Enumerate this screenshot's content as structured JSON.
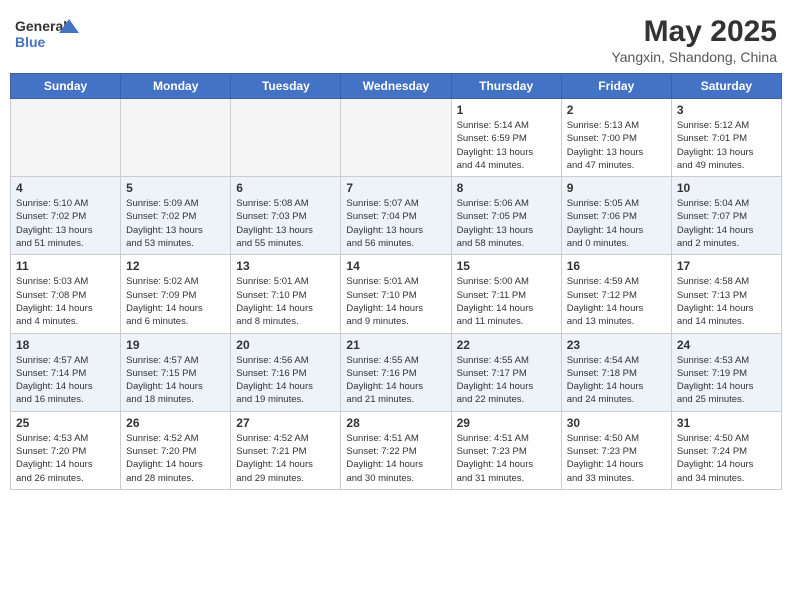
{
  "header": {
    "logo_line1": "General",
    "logo_line2": "Blue",
    "month_title": "May 2025",
    "location": "Yangxin, Shandong, China"
  },
  "days_of_week": [
    "Sunday",
    "Monday",
    "Tuesday",
    "Wednesday",
    "Thursday",
    "Friday",
    "Saturday"
  ],
  "weeks": [
    [
      {
        "day": "",
        "empty": true
      },
      {
        "day": "",
        "empty": true
      },
      {
        "day": "",
        "empty": true
      },
      {
        "day": "",
        "empty": true
      },
      {
        "day": "1",
        "info": "Sunrise: 5:14 AM\nSunset: 6:59 PM\nDaylight: 13 hours\nand 44 minutes."
      },
      {
        "day": "2",
        "info": "Sunrise: 5:13 AM\nSunset: 7:00 PM\nDaylight: 13 hours\nand 47 minutes."
      },
      {
        "day": "3",
        "info": "Sunrise: 5:12 AM\nSunset: 7:01 PM\nDaylight: 13 hours\nand 49 minutes."
      }
    ],
    [
      {
        "day": "4",
        "info": "Sunrise: 5:10 AM\nSunset: 7:02 PM\nDaylight: 13 hours\nand 51 minutes."
      },
      {
        "day": "5",
        "info": "Sunrise: 5:09 AM\nSunset: 7:02 PM\nDaylight: 13 hours\nand 53 minutes."
      },
      {
        "day": "6",
        "info": "Sunrise: 5:08 AM\nSunset: 7:03 PM\nDaylight: 13 hours\nand 55 minutes."
      },
      {
        "day": "7",
        "info": "Sunrise: 5:07 AM\nSunset: 7:04 PM\nDaylight: 13 hours\nand 56 minutes."
      },
      {
        "day": "8",
        "info": "Sunrise: 5:06 AM\nSunset: 7:05 PM\nDaylight: 13 hours\nand 58 minutes."
      },
      {
        "day": "9",
        "info": "Sunrise: 5:05 AM\nSunset: 7:06 PM\nDaylight: 14 hours\nand 0 minutes."
      },
      {
        "day": "10",
        "info": "Sunrise: 5:04 AM\nSunset: 7:07 PM\nDaylight: 14 hours\nand 2 minutes."
      }
    ],
    [
      {
        "day": "11",
        "info": "Sunrise: 5:03 AM\nSunset: 7:08 PM\nDaylight: 14 hours\nand 4 minutes."
      },
      {
        "day": "12",
        "info": "Sunrise: 5:02 AM\nSunset: 7:09 PM\nDaylight: 14 hours\nand 6 minutes."
      },
      {
        "day": "13",
        "info": "Sunrise: 5:01 AM\nSunset: 7:10 PM\nDaylight: 14 hours\nand 8 minutes."
      },
      {
        "day": "14",
        "info": "Sunrise: 5:01 AM\nSunset: 7:10 PM\nDaylight: 14 hours\nand 9 minutes."
      },
      {
        "day": "15",
        "info": "Sunrise: 5:00 AM\nSunset: 7:11 PM\nDaylight: 14 hours\nand 11 minutes."
      },
      {
        "day": "16",
        "info": "Sunrise: 4:59 AM\nSunset: 7:12 PM\nDaylight: 14 hours\nand 13 minutes."
      },
      {
        "day": "17",
        "info": "Sunrise: 4:58 AM\nSunset: 7:13 PM\nDaylight: 14 hours\nand 14 minutes."
      }
    ],
    [
      {
        "day": "18",
        "info": "Sunrise: 4:57 AM\nSunset: 7:14 PM\nDaylight: 14 hours\nand 16 minutes."
      },
      {
        "day": "19",
        "info": "Sunrise: 4:57 AM\nSunset: 7:15 PM\nDaylight: 14 hours\nand 18 minutes."
      },
      {
        "day": "20",
        "info": "Sunrise: 4:56 AM\nSunset: 7:16 PM\nDaylight: 14 hours\nand 19 minutes."
      },
      {
        "day": "21",
        "info": "Sunrise: 4:55 AM\nSunset: 7:16 PM\nDaylight: 14 hours\nand 21 minutes."
      },
      {
        "day": "22",
        "info": "Sunrise: 4:55 AM\nSunset: 7:17 PM\nDaylight: 14 hours\nand 22 minutes."
      },
      {
        "day": "23",
        "info": "Sunrise: 4:54 AM\nSunset: 7:18 PM\nDaylight: 14 hours\nand 24 minutes."
      },
      {
        "day": "24",
        "info": "Sunrise: 4:53 AM\nSunset: 7:19 PM\nDaylight: 14 hours\nand 25 minutes."
      }
    ],
    [
      {
        "day": "25",
        "info": "Sunrise: 4:53 AM\nSunset: 7:20 PM\nDaylight: 14 hours\nand 26 minutes."
      },
      {
        "day": "26",
        "info": "Sunrise: 4:52 AM\nSunset: 7:20 PM\nDaylight: 14 hours\nand 28 minutes."
      },
      {
        "day": "27",
        "info": "Sunrise: 4:52 AM\nSunset: 7:21 PM\nDaylight: 14 hours\nand 29 minutes."
      },
      {
        "day": "28",
        "info": "Sunrise: 4:51 AM\nSunset: 7:22 PM\nDaylight: 14 hours\nand 30 minutes."
      },
      {
        "day": "29",
        "info": "Sunrise: 4:51 AM\nSunset: 7:23 PM\nDaylight: 14 hours\nand 31 minutes."
      },
      {
        "day": "30",
        "info": "Sunrise: 4:50 AM\nSunset: 7:23 PM\nDaylight: 14 hours\nand 33 minutes."
      },
      {
        "day": "31",
        "info": "Sunrise: 4:50 AM\nSunset: 7:24 PM\nDaylight: 14 hours\nand 34 minutes."
      }
    ]
  ]
}
